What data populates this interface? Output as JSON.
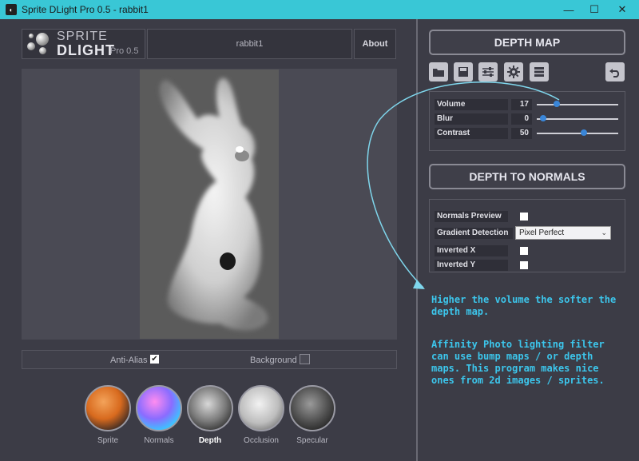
{
  "window": {
    "title": "Sprite DLight Pro 0.5 - rabbit1",
    "minimize": "—",
    "maximize": "☐",
    "close": "✕"
  },
  "header": {
    "logo_line1": "SPRITE",
    "logo_line2": "DLIGHT",
    "version": "Pro 0.5",
    "filename": "rabbit1",
    "about": "About"
  },
  "options": {
    "anti_alias_label": "Anti-Alias",
    "anti_alias_checked": true,
    "background_label": "Background",
    "background_checked": false
  },
  "modes": [
    {
      "label": "Sprite",
      "active": false
    },
    {
      "label": "Normals",
      "active": false
    },
    {
      "label": "Depth",
      "active": true
    },
    {
      "label": "Occlusion",
      "active": false
    },
    {
      "label": "Specular",
      "active": false
    }
  ],
  "depth_map": {
    "button": "DEPTH MAP",
    "tools": [
      "folder-open-icon",
      "save-icon",
      "sliders-icon",
      "gear-icon",
      "layers-icon",
      "undo-icon"
    ],
    "volume": {
      "label": "Volume",
      "value": "17",
      "fraction": 0.17
    },
    "blur": {
      "label": "Blur",
      "value": "0",
      "fraction": 0.0
    },
    "contrast": {
      "label": "Contrast",
      "value": "50",
      "fraction": 0.5
    }
  },
  "normals": {
    "button": "DEPTH TO NORMALS",
    "preview_label": "Normals Preview",
    "gradient_label": "Gradient Detection",
    "gradient_value": "Pixel Perfect",
    "inverted_x_label": "Inverted X",
    "inverted_y_label": "Inverted Y"
  },
  "annotations": {
    "note1": "Higher the volume the softer the depth map.",
    "note2": "Affinity Photo lighting filter can use bump maps / or depth maps. This program makes nice ones from 2d images / sprites."
  },
  "colors": {
    "titlebar": "#39c7d6",
    "accent_blue": "#3a86d8",
    "note_text": "#3cc6ec"
  }
}
